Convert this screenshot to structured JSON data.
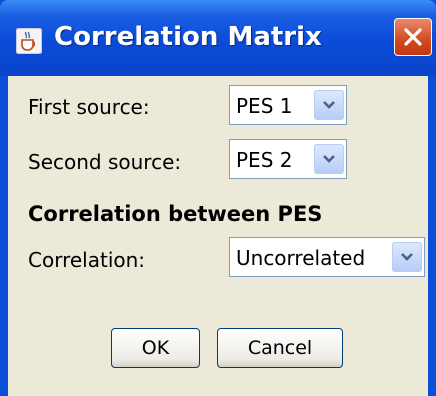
{
  "window": {
    "title": "Correlation Matrix",
    "app_icon": "java-cup-icon",
    "close_icon": "close-icon"
  },
  "form": {
    "first_source_label": "First source:",
    "first_source_value": "PES 1",
    "second_source_label": "Second source:",
    "second_source_value": "PES 2",
    "section_title": "Correlation between PES",
    "correlation_label": "Correlation:",
    "correlation_value": "Uncorrelated"
  },
  "buttons": {
    "ok_label": "OK",
    "cancel_label": "Cancel"
  },
  "colors": {
    "titlebar": "#0a4fd6",
    "client_bg": "#ece9d8",
    "close_button": "#d04a1c"
  }
}
